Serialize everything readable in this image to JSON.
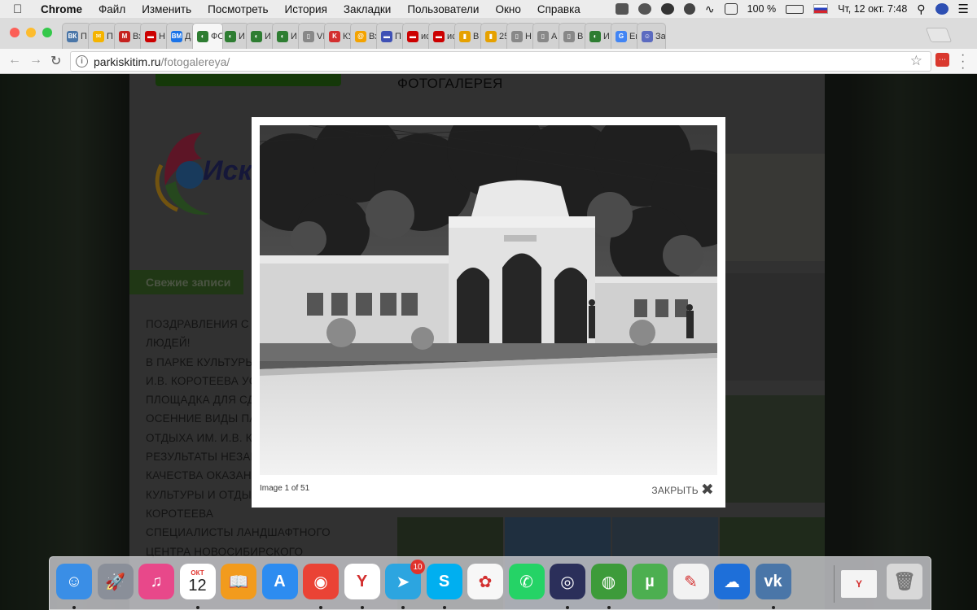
{
  "menubar": {
    "items": [
      "Chrome",
      "Файл",
      "Изменить",
      "Посмотреть",
      "История",
      "Закладки",
      "Пользователи",
      "Окно",
      "Справка"
    ],
    "battery": "100 %",
    "datetime": "Чт, 12 окт.  7:48"
  },
  "tabs": [
    {
      "label": "П",
      "fav": "ВК",
      "color": "#4a76a8"
    },
    {
      "label": "П",
      "fav": "✉",
      "color": "#f5b400"
    },
    {
      "label": "Вх",
      "fav": "M",
      "color": "#c5221f"
    },
    {
      "label": "Н",
      "fav": "▬",
      "color": "#cc0000"
    },
    {
      "label": "Д",
      "fav": "BM",
      "color": "#1a73e8"
    },
    {
      "label": "ФО",
      "fav": "◐",
      "color": "#2e7d32",
      "active": true
    },
    {
      "label": "И",
      "fav": "◐",
      "color": "#2e7d32"
    },
    {
      "label": "И",
      "fav": "◐",
      "color": "#2e7d32"
    },
    {
      "label": "И",
      "fav": "◐",
      "color": "#2e7d32"
    },
    {
      "label": "VI",
      "fav": "▯",
      "color": "#888888"
    },
    {
      "label": "КУ",
      "fav": "K",
      "color": "#d32f2f"
    },
    {
      "label": "Вх",
      "fav": "@",
      "color": "#f4a300"
    },
    {
      "label": "П",
      "fav": "▬",
      "color": "#3f51b5"
    },
    {
      "label": "ис",
      "fav": "▬",
      "color": "#cc0000"
    },
    {
      "label": "ис",
      "fav": "▬",
      "color": "#cc0000"
    },
    {
      "label": "В",
      "fav": "▮",
      "color": "#e6a100"
    },
    {
      "label": "25",
      "fav": "▮",
      "color": "#e6a100"
    },
    {
      "label": "Н",
      "fav": "▯",
      "color": "#888888"
    },
    {
      "label": "А",
      "fav": "▯",
      "color": "#888888"
    },
    {
      "label": "В",
      "fav": "▯",
      "color": "#888888"
    },
    {
      "label": "И",
      "fav": "◐",
      "color": "#2e7d32"
    },
    {
      "label": "Ег",
      "fav": "G",
      "color": "#4285f4"
    },
    {
      "label": "За",
      "fav": "☺",
      "color": "#5c6bc0"
    }
  ],
  "address": {
    "host": "parkiskitim.ru",
    "path": "/fotogalereya/"
  },
  "page": {
    "gallery_title": "ФОТОГАЛЕРЕЯ",
    "logo_text": "Иски",
    "fresh_posts_heading": "Свежие записи",
    "posts": [
      "ПОЗДРАВЛЕНИЯ С Д",
      "ЛЮДЕЙ!",
      "В ПАРКЕ КУЛЬТУРЫ",
      "И.В. КОРОТЕЕВА УСТ",
      "ПЛОЩАДКА ДЛЯ СДА",
      "ОСЕННИЕ ВИДЫ ПАР",
      "ОТДЫХА ИМ. И.В. КО",
      "РЕЗУЛЬТАТЫ НЕЗАВ",
      "КАЧЕСТВА ОКАЗАНИ",
      "КУЛЬТУРЫ И ОТДЫХ",
      "КОРОТЕЕВА",
      "СПЕЦИАЛИСТЫ ЛАНДШАФТНОГО",
      "ЦЕНТРА НОВОСИБИРСКОГО"
    ]
  },
  "lightbox": {
    "caption": "Image 1 of 51",
    "close_label": "ЗАКРЫТЬ"
  },
  "dock": {
    "calendar_month": "ОКТ",
    "calendar_day": "12",
    "telegram_badge": "10",
    "apps": [
      {
        "name": "finder-icon",
        "color": "#3a8ee6",
        "glyph": "☺"
      },
      {
        "name": "launchpad-icon",
        "color": "#8a8f99",
        "glyph": "🚀"
      },
      {
        "name": "itunes-icon",
        "color": "#e8488a",
        "glyph": "♫"
      },
      {
        "name": "calendar-icon",
        "color": "#ffffff",
        "glyph": ""
      },
      {
        "name": "ibooks-icon",
        "color": "#f29b1d",
        "glyph": "📖"
      },
      {
        "name": "app-store-icon",
        "color": "#2d8cf0",
        "glyph": "A"
      },
      {
        "name": "chrome-icon",
        "color": "#ea4335",
        "glyph": "◉"
      },
      {
        "name": "yandex-browser-icon",
        "color": "#ffffff",
        "glyph": "Y"
      },
      {
        "name": "telegram-icon",
        "color": "#2ca5e0",
        "glyph": "➤"
      },
      {
        "name": "skype-icon",
        "color": "#00aff0",
        "glyph": "S"
      },
      {
        "name": "photos-icon",
        "color": "#f7f7f7",
        "glyph": "✿"
      },
      {
        "name": "whatsapp-icon",
        "color": "#25d366",
        "glyph": "✆"
      },
      {
        "name": "siri-icon",
        "color": "#2b2f5a",
        "glyph": "◎"
      },
      {
        "name": "network-globe-icon",
        "color": "#3d9b3a",
        "glyph": "◍"
      },
      {
        "name": "utorrent-icon",
        "color": "#4caf50",
        "glyph": "µ"
      },
      {
        "name": "notes-icon",
        "color": "#f2f2f2",
        "glyph": "✎"
      },
      {
        "name": "openoffice-icon",
        "color": "#1e6fd9",
        "glyph": "☁"
      },
      {
        "name": "vk-icon",
        "color": "#4a76a8",
        "glyph": "vk"
      }
    ]
  }
}
